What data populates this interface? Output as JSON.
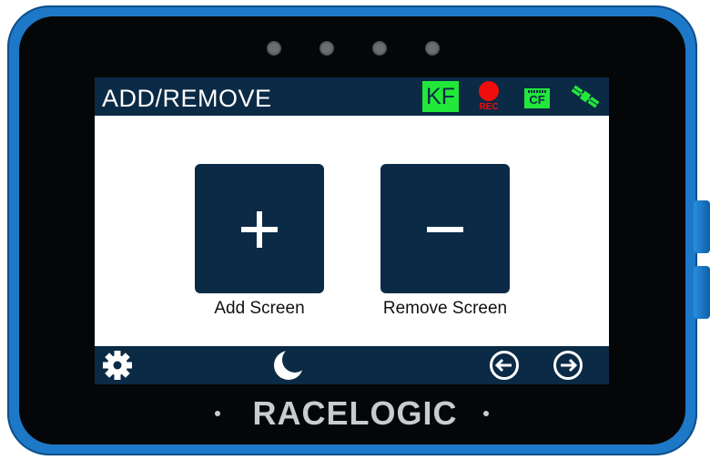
{
  "device": {
    "brand": "RACELOGIC",
    "accent": "#1e78c8"
  },
  "header": {
    "title": "ADD/REMOVE",
    "status": {
      "kf": "KF",
      "rec": "REC",
      "cf": "CF",
      "icons": [
        "kf-badge-icon",
        "record-icon",
        "cf-card-icon",
        "satellite-icon"
      ],
      "colors": {
        "ok": "#22e83a",
        "rec": "#f20d0d",
        "bar": "#0b2a45"
      }
    }
  },
  "main": {
    "tiles": [
      {
        "label": "Add Screen",
        "icon": "plus-icon"
      },
      {
        "label": "Remove Screen",
        "icon": "minus-icon"
      }
    ]
  },
  "footer": {
    "icons": [
      "gear-icon",
      "moon-icon",
      "arrow-left-icon",
      "arrow-right-icon"
    ]
  }
}
